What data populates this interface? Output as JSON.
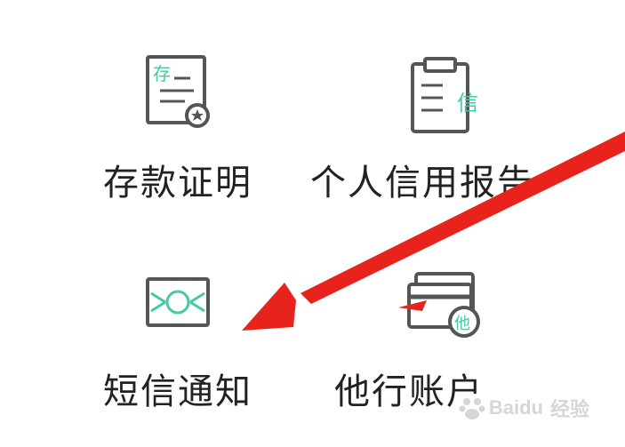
{
  "menu": {
    "items": [
      {
        "label": "存款证明",
        "icon": "deposit-certificate-icon",
        "icon_text": "存"
      },
      {
        "label": "个人信用报告",
        "icon": "credit-report-clipboard-icon",
        "icon_text": "信"
      },
      {
        "label": "短信通知",
        "icon": "sms-envelope-icon"
      },
      {
        "label": "他行账户",
        "icon": "other-bank-cards-icon",
        "icon_text": "他"
      }
    ]
  },
  "colors": {
    "icon_stroke": "#555555",
    "icon_accent": "#47c9a2",
    "arrow": "#e8221c",
    "label_text": "#222222"
  },
  "watermark": {
    "brand": "Baidu",
    "sub": "经验"
  }
}
